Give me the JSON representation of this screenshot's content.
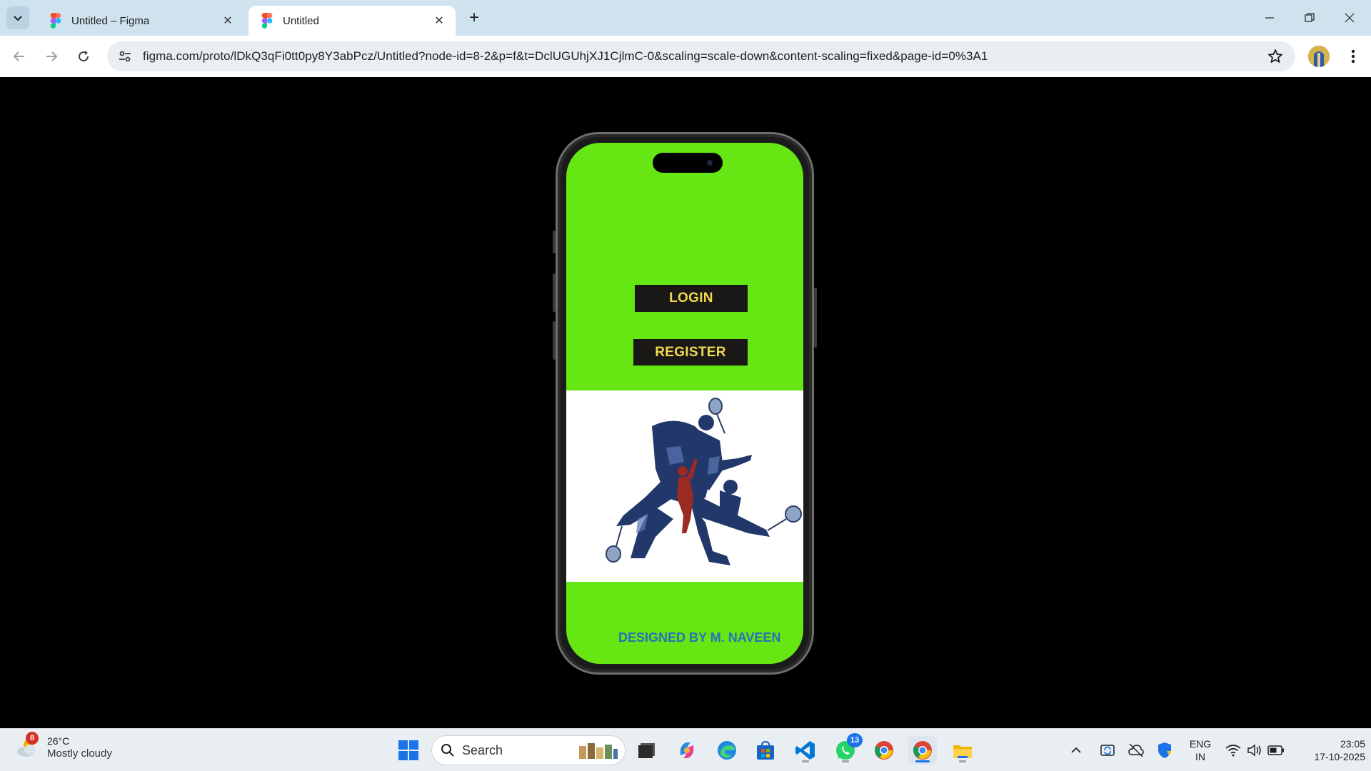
{
  "browser": {
    "tabs": [
      {
        "title": "Untitled – Figma",
        "active": false
      },
      {
        "title": "Untitled",
        "active": true
      }
    ],
    "url": "figma.com/proto/lDkQ3qFi0tt0py8Y3abPcz/Untitled?node-id=8-2&p=f&t=DclUGUhjXJ1CjlmC-0&scaling=scale-down&content-scaling=fixed&page-id=0%3A1"
  },
  "app": {
    "login_label": "LOGIN",
    "register_label": "REGISTER",
    "credit": "DESIGNED BY M. NAVEEN",
    "colors": {
      "background": "#66e612",
      "button": "#1a1717",
      "button_text": "#f0d94a",
      "credit": "#2673b5"
    }
  },
  "taskbar": {
    "weather_badge": "8",
    "temperature": "26°C",
    "condition": "Mostly cloudy",
    "search_label": "Search",
    "whatsapp_badge": "13",
    "language_line1": "ENG",
    "language_line2": "IN",
    "time": "23:05",
    "date": "17-10-2025"
  }
}
